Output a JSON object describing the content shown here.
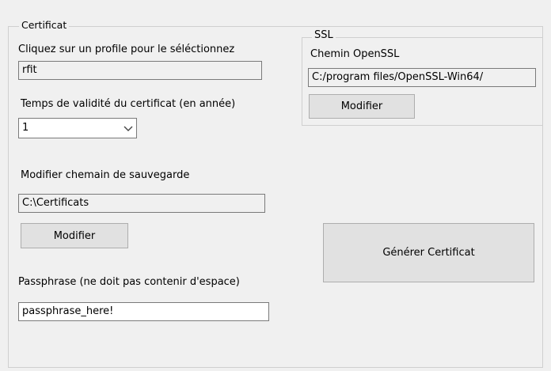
{
  "certificate_group": {
    "legend": "Certificat"
  },
  "profile": {
    "label": "Cliquez sur un profile pour le séléctionnez",
    "value": "rfit"
  },
  "validity": {
    "label": "Temps de validité du certificat (en année)",
    "selected": "1"
  },
  "save_path": {
    "label": "Modifier chemain de sauvegarde",
    "value": "C:\\Certificats",
    "button_label": "Modifier"
  },
  "passphrase": {
    "label": "Passphrase (ne doit pas contenir d'espace)",
    "value": "passphrase_here!"
  },
  "ssl_group": {
    "legend": "SSL",
    "path_label": "Chemin OpenSSL",
    "path_value": "C:/program files/OpenSSL-Win64/",
    "button_label": "Modifier"
  },
  "generate": {
    "button_label": "Générer Certificat"
  },
  "icons": {
    "combo_arrow": "chevron-down-icon"
  }
}
